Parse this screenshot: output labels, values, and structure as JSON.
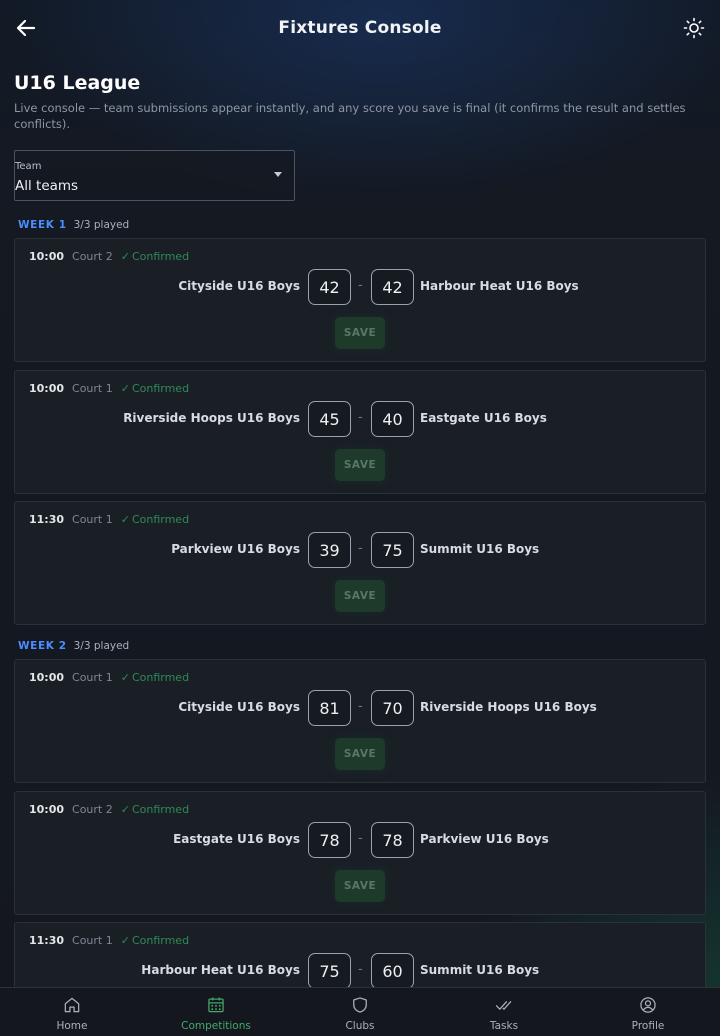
{
  "header": {
    "title": "Fixtures Console"
  },
  "league": {
    "name": "U16 League",
    "description": "Live console — team submissions appear instantly, and any score you save is final (it confirms the result and settles conflicts)."
  },
  "filter": {
    "label": "Team",
    "value": "All teams"
  },
  "weeks": [
    {
      "label": "WEEK 1",
      "played": "3/3 played",
      "fixtures": [
        {
          "time": "10:00",
          "court": "Court 2",
          "status": "Confirmed",
          "home": "Cityside U16 Boys",
          "home_score": "42",
          "away_score": "42",
          "away": "Harbour Heat U16 Boys",
          "save": "SAVE"
        },
        {
          "time": "10:00",
          "court": "Court 1",
          "status": "Confirmed",
          "home": "Riverside Hoops U16 Boys",
          "home_score": "45",
          "away_score": "40",
          "away": "Eastgate U16 Boys",
          "save": "SAVE"
        },
        {
          "time": "11:30",
          "court": "Court 1",
          "status": "Confirmed",
          "home": "Parkview U16 Boys",
          "home_score": "39",
          "away_score": "75",
          "away": "Summit U16 Boys",
          "save": "SAVE"
        }
      ]
    },
    {
      "label": "WEEK 2",
      "played": "3/3 played",
      "fixtures": [
        {
          "time": "10:00",
          "court": "Court 1",
          "status": "Confirmed",
          "home": "Cityside U16 Boys",
          "home_score": "81",
          "away_score": "70",
          "away": "Riverside Hoops U16 Boys",
          "save": "SAVE"
        },
        {
          "time": "10:00",
          "court": "Court 2",
          "status": "Confirmed",
          "home": "Eastgate U16 Boys",
          "home_score": "78",
          "away_score": "78",
          "away": "Parkview U16 Boys",
          "save": "SAVE"
        },
        {
          "time": "11:30",
          "court": "Court 1",
          "status": "Confirmed",
          "home": "Harbour Heat U16 Boys",
          "home_score": "75",
          "away_score": "60",
          "away": "Summit U16 Boys",
          "save": "SAVE"
        }
      ]
    }
  ],
  "nav": [
    {
      "label": "Home",
      "icon": "home-icon",
      "active": false
    },
    {
      "label": "Competitions",
      "icon": "calendar-icon",
      "active": true
    },
    {
      "label": "Clubs",
      "icon": "shield-icon",
      "active": false
    },
    {
      "label": "Tasks",
      "icon": "double-check-icon",
      "active": false
    },
    {
      "label": "Profile",
      "icon": "profile-icon",
      "active": false
    }
  ],
  "colors": {
    "accent_green": "#43a86a",
    "week_blue": "#4c8dff",
    "confirmed_green": "#2f8a55"
  }
}
